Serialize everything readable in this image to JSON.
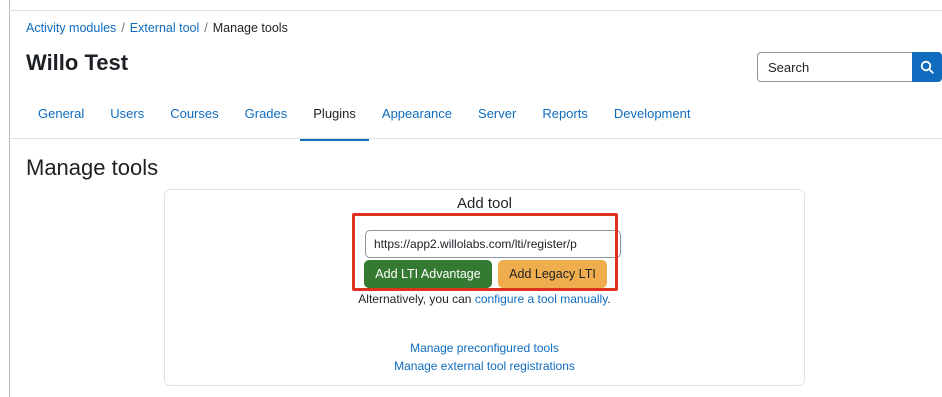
{
  "breadcrumb": {
    "items": [
      {
        "label": "Activity modules"
      },
      {
        "label": "External tool"
      }
    ],
    "separator": "/",
    "current": "Manage tools"
  },
  "site": {
    "title": "Willo Test"
  },
  "search": {
    "placeholder": "Search",
    "icon": "search-icon"
  },
  "nav": {
    "tabs": [
      "General",
      "Users",
      "Courses",
      "Grades",
      "Plugins",
      "Appearance",
      "Server",
      "Reports",
      "Development"
    ],
    "active": "Plugins"
  },
  "page": {
    "heading": "Manage tools"
  },
  "add_tool": {
    "title": "Add tool",
    "url_value": "https://app2.willolabs.com/lti/register/p",
    "advantage_label": "Add LTI Advantage",
    "legacy_label": "Add Legacy LTI",
    "alt_prefix": "Alternatively, you can",
    "alt_link": "configure a tool manually",
    "alt_suffix": "."
  },
  "links": {
    "preconfigured": "Manage preconfigured tools",
    "registrations": "Manage external tool registrations"
  },
  "colors": {
    "link": "#0f6cbf",
    "advantage_button": "#357a32",
    "legacy_button": "#f0ad4e",
    "highlight": "#e03021"
  }
}
